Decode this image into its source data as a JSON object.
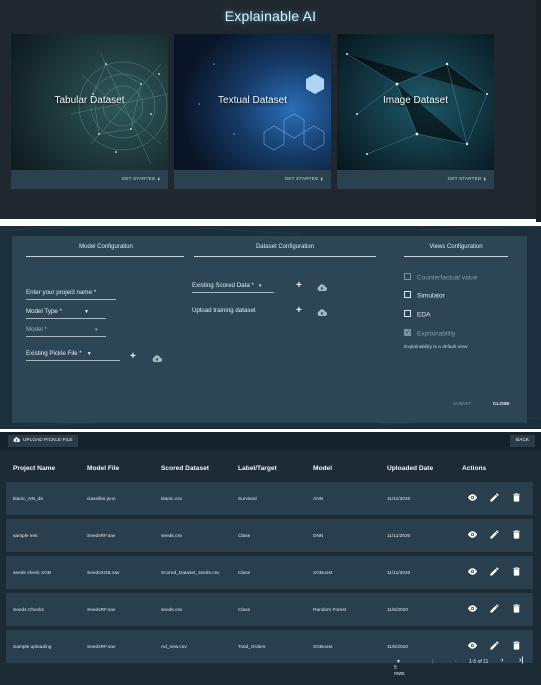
{
  "panel1": {
    "title": "Explainable AI",
    "cards": [
      {
        "label": "Tabular Dataset",
        "cta": "GET STARTED"
      },
      {
        "label": "Textual Dataset",
        "cta": "GET STARTED"
      },
      {
        "label": "Image Dataset",
        "cta": "GET STARTED"
      }
    ]
  },
  "panel2": {
    "model_config": {
      "heading": "Model Configuration",
      "project_name": "Enter your project name *",
      "model_type": "Model Type *",
      "model": "Model *",
      "pickle": "Existing Pickle File *"
    },
    "dataset_config": {
      "heading": "Dataset Configuration",
      "scored": "Existing Scored Data *",
      "upload": "Upload training dataset"
    },
    "views_config": {
      "heading": "Views Configuration",
      "options": [
        {
          "label": "Counterfactual value",
          "state": "disabled"
        },
        {
          "label": "Simulator",
          "state": "unchecked"
        },
        {
          "label": "EDA",
          "state": "unchecked"
        },
        {
          "label": "Explainability",
          "state": "checked-disabled"
        }
      ],
      "note": "Explainability is a default view"
    },
    "submit_label": "SUBMIT",
    "close_label": "CLOSE"
  },
  "panel3": {
    "upload_label": "UPLOAD PICKLE FILE",
    "back_label": "BACK",
    "columns": [
      "Project Name",
      "Model File",
      "Scored Dataset",
      "Label/Target",
      "Model",
      "Uploaded Date",
      "Actions"
    ],
    "rows": [
      [
        "titanic_NN_ds",
        "classifier.json",
        "titanic.csv",
        "Survived",
        "ANN",
        "11/11/2020"
      ],
      [
        "sample test",
        "SeedsRF.sav",
        "seeds.csv",
        "Class",
        "DNN",
        "11/11/2020"
      ],
      [
        "seeds check XGB",
        "SeedsXGB.sav",
        "Scored_Dataset_seeds.csv",
        "Class",
        "XGBoost",
        "11/11/2020"
      ],
      [
        "Seeds Check1",
        "SeedsRF.sav",
        "seeds.csv",
        "Class",
        "Random Forest",
        "11/6/2020"
      ],
      [
        "Sample uploading",
        "SeedsRF.sav",
        "Ad_new.csv",
        "Total_Orders",
        "XGBoost",
        "11/6/2020"
      ]
    ],
    "pager": {
      "rows": "5 rows",
      "range": "1-5 of 11"
    }
  },
  "colors": {
    "accent": "#2c4656",
    "card_footer": "#2c4150",
    "row": "#2a3f4d"
  }
}
